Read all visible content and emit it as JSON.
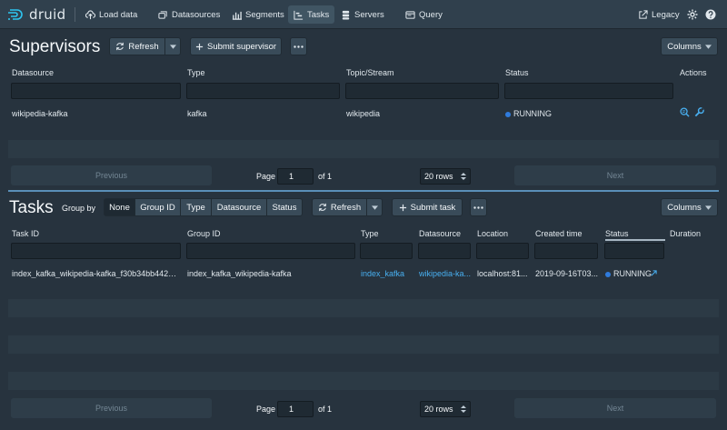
{
  "header": {
    "brand": "druid",
    "nav": [
      {
        "label": "Load data",
        "icon": "cloud-upload-icon"
      },
      {
        "label": "Datasources",
        "icon": "multi-select-icon"
      },
      {
        "label": "Segments",
        "icon": "stacked-chart-icon"
      },
      {
        "label": "Tasks",
        "icon": "gantt-chart-icon",
        "active": true
      },
      {
        "label": "Servers",
        "icon": "database-icon"
      },
      {
        "label": "Query",
        "icon": "application-icon"
      }
    ],
    "legacy": "Legacy"
  },
  "supervisors": {
    "title": "Supervisors",
    "refresh": "Refresh",
    "submit": "Submit supervisor",
    "columns_label": "Columns",
    "columns": [
      "Datasource",
      "Type",
      "Topic/Stream",
      "Status",
      "Actions"
    ],
    "rows": [
      {
        "datasource": "wikipedia-kafka",
        "type": "kafka",
        "topic": "wikipedia",
        "status": "RUNNING"
      }
    ],
    "pager": {
      "previous": "Previous",
      "page": "Page",
      "page_value": "1",
      "of": "of 1",
      "rows": "20 rows",
      "next": "Next"
    }
  },
  "tasks": {
    "title": "Tasks",
    "group_by": "Group by",
    "groups": [
      "None",
      "Group ID",
      "Type",
      "Datasource",
      "Status"
    ],
    "refresh": "Refresh",
    "submit": "Submit task",
    "columns_label": "Columns",
    "columns": [
      "Task ID",
      "Group ID",
      "Type",
      "Datasource",
      "Location",
      "Created time",
      "Status",
      "Duration"
    ],
    "rows": [
      {
        "task_id": "index_kafka_wikipedia-kafka_f30b34bb4427f...",
        "group_id": "index_kafka_wikipedia-kafka",
        "type": "index_kafka",
        "datasource": "wikipedia-ka...",
        "location": "localhost:81...",
        "created": "2019-09-16T03...",
        "status": "RUNNING",
        "duration": ""
      }
    ],
    "pager": {
      "previous": "Previous",
      "page": "Page",
      "page_value": "1",
      "of": "of 1",
      "rows": "20 rows",
      "next": "Next"
    }
  },
  "colors": {
    "background": "#27333e",
    "header": "#30404d",
    "link": "#48aff0",
    "running": "#2f7bdc"
  }
}
